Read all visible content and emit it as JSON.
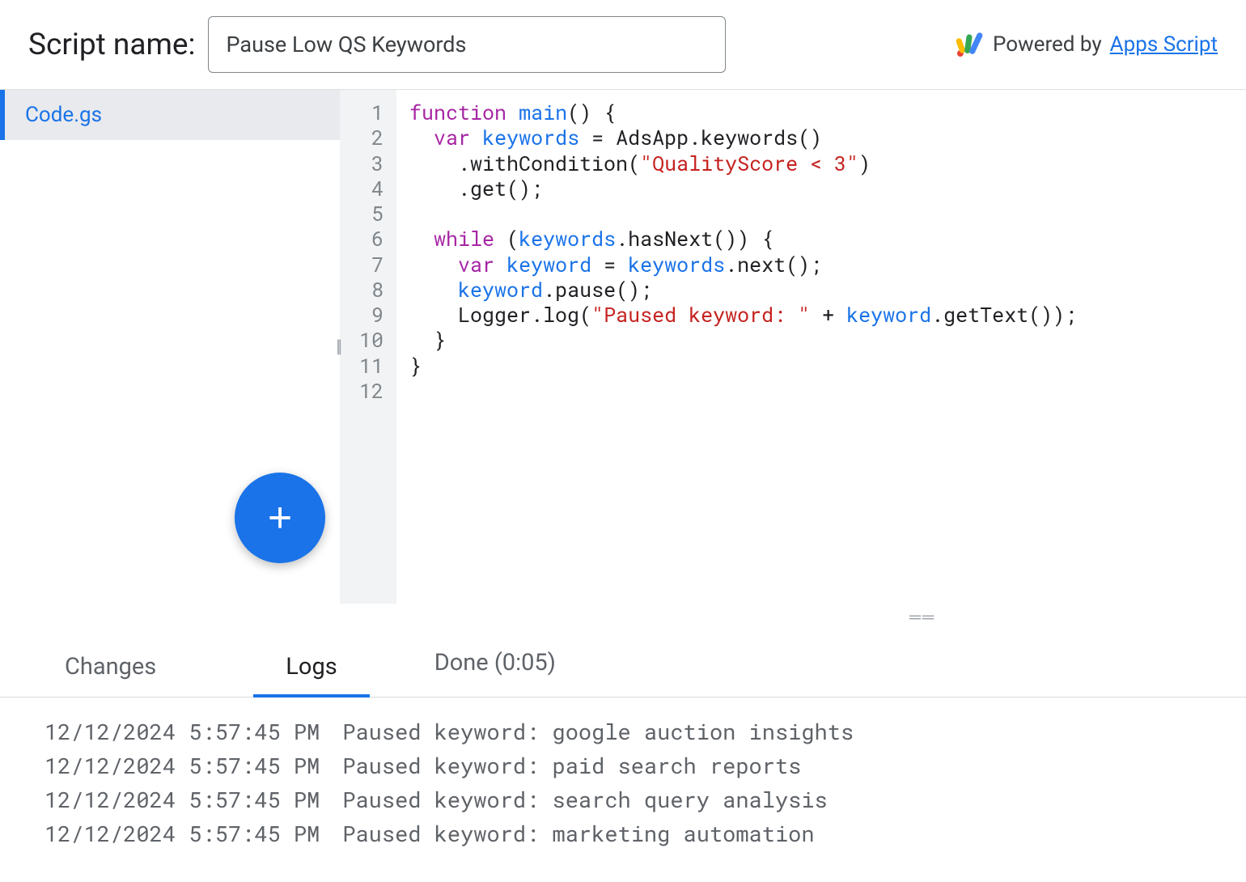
{
  "header": {
    "label": "Script name:",
    "script_name": "Pause Low QS Keywords",
    "powered_prefix": "Powered by ",
    "powered_link": "Apps Script"
  },
  "sidebar": {
    "files": [
      {
        "name": "Code.gs",
        "active": true
      }
    ],
    "fab_label": "+"
  },
  "editor": {
    "line_numbers": [
      "1",
      "2",
      "3",
      "4",
      "5",
      "6",
      "7",
      "8",
      "9",
      "10",
      "11",
      "12"
    ],
    "code_tokens": [
      [
        [
          "function",
          "kw"
        ],
        [
          " "
        ],
        [
          "main",
          "fn"
        ],
        [
          "() {"
        ]
      ],
      [
        [
          "  "
        ],
        [
          "var",
          "kw"
        ],
        [
          " "
        ],
        [
          "keywords",
          "blue"
        ],
        [
          " = AdsApp.keywords()"
        ]
      ],
      [
        [
          "    .withCondition("
        ],
        [
          "\"QualityScore < 3\"",
          "str"
        ],
        [
          ")"
        ]
      ],
      [
        [
          "    .get();"
        ]
      ],
      [
        [
          ""
        ]
      ],
      [
        [
          "  "
        ],
        [
          "while",
          "kw"
        ],
        [
          " ("
        ],
        [
          "keywords",
          "blue"
        ],
        [
          ".hasNext()) {"
        ]
      ],
      [
        [
          "    "
        ],
        [
          "var",
          "kw"
        ],
        [
          " "
        ],
        [
          "keyword",
          "blue"
        ],
        [
          " = "
        ],
        [
          "keywords",
          "blue"
        ],
        [
          ".next();"
        ]
      ],
      [
        [
          "    "
        ],
        [
          "keyword",
          "blue"
        ],
        [
          ".pause();"
        ]
      ],
      [
        [
          "    Logger.log("
        ],
        [
          "\"Paused keyword: \"",
          "str"
        ],
        [
          " + "
        ],
        [
          "keyword",
          "blue"
        ],
        [
          ".getText());"
        ]
      ],
      [
        [
          "  }"
        ]
      ],
      [
        [
          "}"
        ]
      ],
      [
        [
          ""
        ]
      ]
    ]
  },
  "bottom": {
    "tabs": [
      {
        "label": "Changes",
        "active": false
      },
      {
        "label": "Logs",
        "active": true
      }
    ],
    "status": "Done (0:05)"
  },
  "logs": [
    {
      "timestamp": "12/12/2024 5:57:45 PM",
      "message": "Paused keyword: google auction insights"
    },
    {
      "timestamp": "12/12/2024 5:57:45 PM",
      "message": "Paused keyword: paid search reports"
    },
    {
      "timestamp": "12/12/2024 5:57:45 PM",
      "message": "Paused keyword: search query analysis"
    },
    {
      "timestamp": "12/12/2024 5:57:45 PM",
      "message": "Paused keyword: marketing automation"
    }
  ]
}
